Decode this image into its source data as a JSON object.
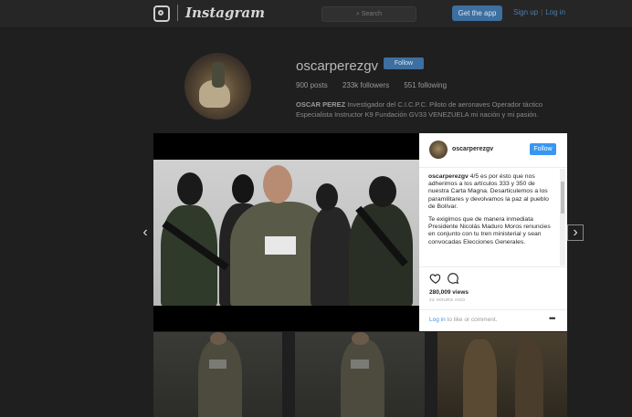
{
  "header": {
    "wordmark": "Instagram",
    "search_placeholder": "Search",
    "get_app": "Get the app",
    "sign_up": "Sign up",
    "log_in": "Log in"
  },
  "profile": {
    "username": "oscarperezgv",
    "follow_label": "Follow",
    "posts": "900 posts",
    "followers": "233k followers",
    "following": "551 following",
    "bio_name": "OSCAR PEREZ",
    "bio_text": "Investigador del C.I.C.P.C. Piloto de aeronaves Operador táctico Especialista Instructor K9 Fundación GV33 VENEZUELA mi nación y mi pasión."
  },
  "post": {
    "username": "oscarperezgv",
    "follow_label": "Follow",
    "caption_user": "oscarperezgv",
    "caption_p1": "4/5 es por ésto que nos adherimos a los artículos 333 y 350 de nuestra Carta Magna. Desarticulemos a los paramilitares y devolvamos la paz al pueblo de Bolívar.",
    "caption_p2": "Te exigimos que de manera inmediata Presidente Nicolás Maduro Moros renuncies en conjunto con tu tren ministerial y sean convocadas Elecciones Generales.",
    "views": "280,009 views",
    "time": "22 HOURS AGO",
    "login_link": "Log in",
    "login_rest": "to like or comment.",
    "more": "•••"
  },
  "nav": {
    "prev": "‹",
    "next": "›"
  },
  "colors": {
    "accent": "#3897f0",
    "background": "#1f1f1f"
  }
}
